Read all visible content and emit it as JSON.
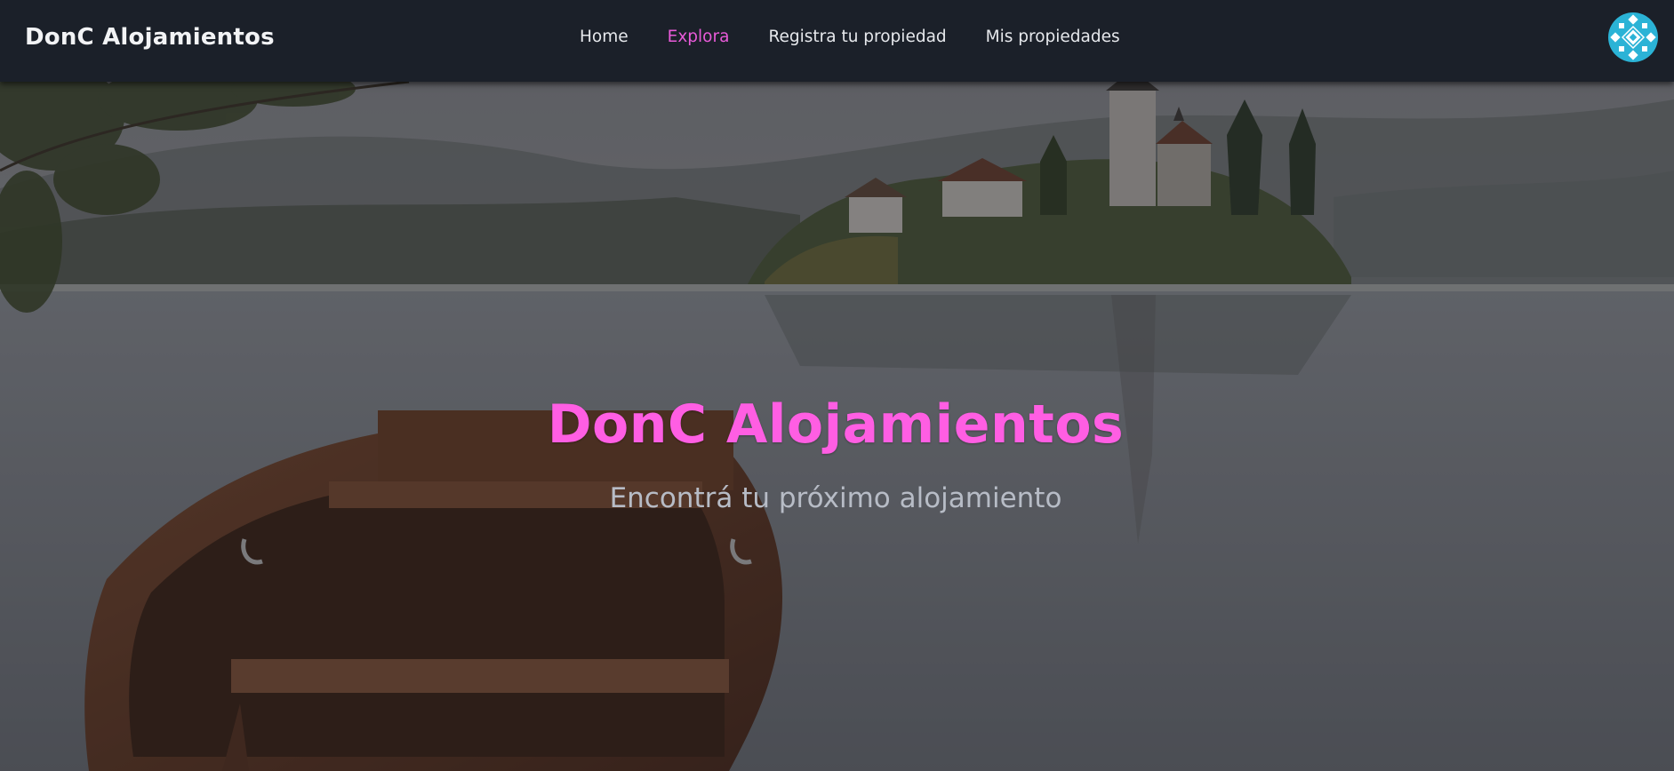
{
  "navbar": {
    "brand": "DonC Alojamientos",
    "links": [
      {
        "label": "Home",
        "active": false
      },
      {
        "label": "Explora",
        "active": true
      },
      {
        "label": "Registra tu propiedad",
        "active": false
      },
      {
        "label": "Mis propiedades",
        "active": false
      }
    ],
    "avatar_icon": "user-avatar-pattern-icon"
  },
  "hero": {
    "title": "DonC Alojamientos",
    "subtitle": "Encontrá tu próximo alojamiento",
    "background": "lake-island-church-boat-photo"
  },
  "colors": {
    "navbar_bg": "#1b2029",
    "accent": "#e85ad8",
    "hero_title": "#ff5ee3",
    "hero_subtitle": "#b7bcc6",
    "avatar_primary": "#2bb3d6"
  }
}
